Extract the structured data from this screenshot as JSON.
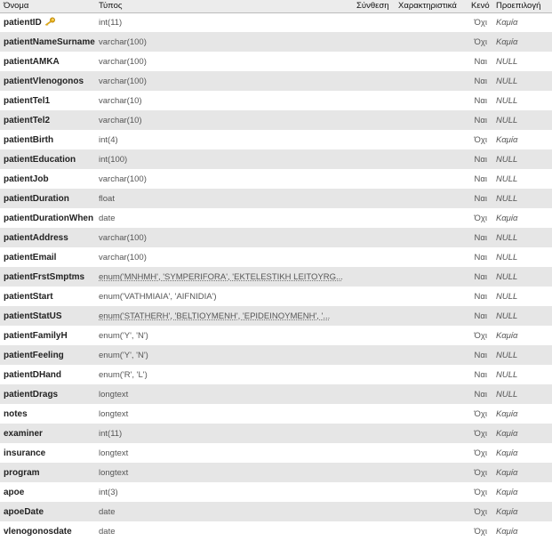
{
  "header": {
    "name": "Όνομα",
    "type": "Τύπος",
    "collation": "Σύνθεση",
    "attributes": "Χαρακτηριστικά",
    "null": "Κενό",
    "default": "Προεπιλογή"
  },
  "rows": [
    {
      "name": "patientID",
      "type": "int(11)",
      "null": "Όχι",
      "default": "Καμία",
      "primary_key": true,
      "enum": false
    },
    {
      "name": "patientNameSurname",
      "type": "varchar(100)",
      "null": "Όχι",
      "default": "Καμία",
      "enum": false
    },
    {
      "name": "patientAMKA",
      "type": "varchar(100)",
      "null": "Ναι",
      "default": "NULL",
      "enum": false
    },
    {
      "name": "patientVlenogonos",
      "type": "varchar(100)",
      "null": "Ναι",
      "default": "NULL",
      "enum": false
    },
    {
      "name": "patientTel1",
      "type": "varchar(10)",
      "null": "Ναι",
      "default": "NULL",
      "enum": false
    },
    {
      "name": "patientTel2",
      "type": "varchar(10)",
      "null": "Ναι",
      "default": "NULL",
      "enum": false
    },
    {
      "name": "patientBirth",
      "type": "int(4)",
      "null": "Όχι",
      "default": "Καμία",
      "enum": false
    },
    {
      "name": "patientEducation",
      "type": "int(100)",
      "null": "Ναι",
      "default": "NULL",
      "enum": false
    },
    {
      "name": "patientJob",
      "type": "varchar(100)",
      "null": "Ναι",
      "default": "NULL",
      "enum": false
    },
    {
      "name": "patientDuration",
      "type": "float",
      "null": "Ναι",
      "default": "NULL",
      "enum": false
    },
    {
      "name": "patientDurationWhen",
      "type": "date",
      "null": "Όχι",
      "default": "Καμία",
      "enum": false
    },
    {
      "name": "patientAddress",
      "type": "varchar(100)",
      "null": "Ναι",
      "default": "NULL",
      "enum": false
    },
    {
      "name": "patientEmail",
      "type": "varchar(100)",
      "null": "Ναι",
      "default": "NULL",
      "enum": false
    },
    {
      "name": "patientFrstSmptms",
      "type": "enum('MNHMH', 'SYMPERIFORA', 'EKTELESTIKH LEITOYRG...",
      "null": "Ναι",
      "default": "NULL",
      "enum": true
    },
    {
      "name": "patientStart",
      "type": "enum('VATHMIAIA', 'AIFNIDIA')",
      "null": "Ναι",
      "default": "NULL",
      "enum": false
    },
    {
      "name": "patientStatUS",
      "type": "enum('STATHERH', 'BELTIOYMENH', 'EPIDEINOYMENH', '...",
      "null": "Ναι",
      "default": "NULL",
      "enum": true
    },
    {
      "name": "patientFamilyH",
      "type": "enum('Y', 'N')",
      "null": "Όχι",
      "default": "Καμία",
      "enum": false
    },
    {
      "name": "patientFeeling",
      "type": "enum('Y', 'N')",
      "null": "Ναι",
      "default": "NULL",
      "enum": false
    },
    {
      "name": "patientDHand",
      "type": "enum('R', 'L')",
      "null": "Ναι",
      "default": "NULL",
      "enum": false
    },
    {
      "name": "patientDrags",
      "type": "longtext",
      "null": "Ναι",
      "default": "NULL",
      "enum": false
    },
    {
      "name": "notes",
      "type": "longtext",
      "null": "Όχι",
      "default": "Καμία",
      "enum": false
    },
    {
      "name": "examiner",
      "type": "int(11)",
      "null": "Όχι",
      "default": "Καμία",
      "enum": false
    },
    {
      "name": "insurance",
      "type": "longtext",
      "null": "Όχι",
      "default": "Καμία",
      "enum": false
    },
    {
      "name": "program",
      "type": "longtext",
      "null": "Όχι",
      "default": "Καμία",
      "enum": false
    },
    {
      "name": "apoe",
      "type": "int(3)",
      "null": "Όχι",
      "default": "Καμία",
      "enum": false
    },
    {
      "name": "apoeDate",
      "type": "date",
      "null": "Όχι",
      "default": "Καμία",
      "enum": false
    },
    {
      "name": "vlenogonosdate",
      "type": "date",
      "null": "Όχι",
      "default": "Καμία",
      "enum": false
    }
  ],
  "colors": {
    "header_bg": "#ececec",
    "row_alt": "#e6e6e6",
    "key_icon": "#e8b21c"
  }
}
